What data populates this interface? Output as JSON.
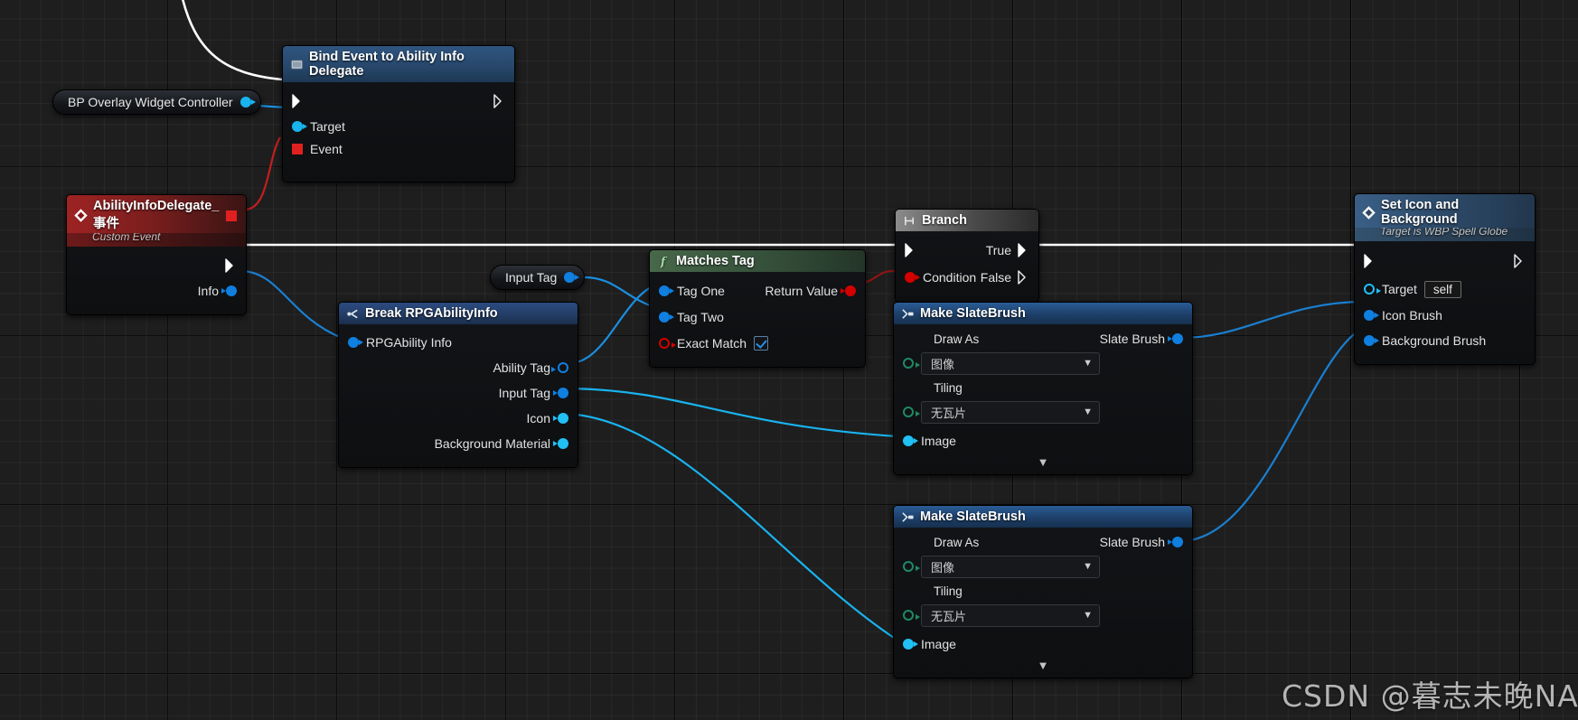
{
  "app": {
    "name": "Unreal Engine Blueprint Graph"
  },
  "watermark": {
    "text": "CSDN @暮志未晚NAN"
  },
  "nodes": {
    "overlay_controller": {
      "title": "BP Overlay Widget Controller",
      "out_pin_name": "object-output-pin"
    },
    "bind_event": {
      "title": "Bind Event to Ability Info Delegate",
      "icon": "delegate-bind-icon",
      "inputs": [
        {
          "label": "Target",
          "type": "object"
        },
        {
          "label": "Event",
          "type": "delegate"
        }
      ],
      "exec_in": "exec-in",
      "exec_out": "exec-out"
    },
    "custom_event": {
      "title": "AbilityInfoDelegate_事件",
      "subtitle": "Custom Event",
      "icon": "event-diamond-icon",
      "outputs": [
        {
          "label": "Info",
          "type": "struct"
        }
      ],
      "delegate_pin": "delegate-output-pin"
    },
    "input_tag_get": {
      "title": "Input Tag"
    },
    "break_info": {
      "title": "Break RPGAbilityInfo",
      "icon": "break-struct-icon",
      "inputs": [
        {
          "label": "RPGAbility Info",
          "type": "struct"
        }
      ],
      "outputs": [
        {
          "label": "Ability Tag",
          "type": "struct-hollow"
        },
        {
          "label": "Input Tag",
          "type": "struct"
        },
        {
          "label": "Icon",
          "type": "object"
        },
        {
          "label": "Background Material",
          "type": "object"
        }
      ]
    },
    "matches_tag": {
      "title": "Matches Tag",
      "icon": "function-f-icon",
      "inputs": [
        {
          "label": "Tag One",
          "type": "struct"
        },
        {
          "label": "Tag Two",
          "type": "struct"
        },
        {
          "label": "Exact Match",
          "type": "bool",
          "value": true
        }
      ],
      "outputs": [
        {
          "label": "Return Value",
          "type": "bool"
        }
      ]
    },
    "branch": {
      "title": "Branch",
      "icon": "branch-icon",
      "inputs": [
        {
          "label": "Condition",
          "type": "bool"
        }
      ],
      "outputs": [
        {
          "label": "True",
          "type": "exec"
        },
        {
          "label": "False",
          "type": "exec"
        }
      ]
    },
    "make_slate_brush_1": {
      "title": "Make SlateBrush",
      "icon": "make-struct-icon",
      "fields": [
        {
          "label": "Draw As",
          "value": "图像",
          "widget": "dropdown"
        },
        {
          "label": "Tiling",
          "value": "无瓦片",
          "widget": "dropdown"
        }
      ],
      "inputs": [
        {
          "label": "Image",
          "type": "object"
        }
      ],
      "outputs": [
        {
          "label": "Slate Brush",
          "type": "struct"
        }
      ],
      "expander": "chevron-down-icon"
    },
    "make_slate_brush_2": {
      "title": "Make SlateBrush",
      "icon": "make-struct-icon",
      "fields": [
        {
          "label": "Draw As",
          "value": "图像",
          "widget": "dropdown"
        },
        {
          "label": "Tiling",
          "value": "无瓦片",
          "widget": "dropdown"
        }
      ],
      "inputs": [
        {
          "label": "Image",
          "type": "object"
        }
      ],
      "outputs": [
        {
          "label": "Slate Brush",
          "type": "struct"
        }
      ],
      "expander": "chevron-down-icon"
    },
    "set_icon_bg": {
      "title": "Set Icon and Background",
      "subtitle": "Target is WBP Spell Globe",
      "icon": "function-diamond-icon",
      "inputs": [
        {
          "label": "Target",
          "type": "object-hollow",
          "value": "self"
        },
        {
          "label": "Icon Brush",
          "type": "struct"
        },
        {
          "label": "Background Brush",
          "type": "struct"
        }
      ]
    }
  },
  "colors": {
    "exec_wire": "#ffffff",
    "object_wire": "#0f7fe0",
    "struct_wire": "#19b3ee",
    "delegate_wire": "#d40000",
    "bool_wire": "#8b1010",
    "node_bg": "#101215",
    "canvas_bg": "#1e1e1e"
  }
}
